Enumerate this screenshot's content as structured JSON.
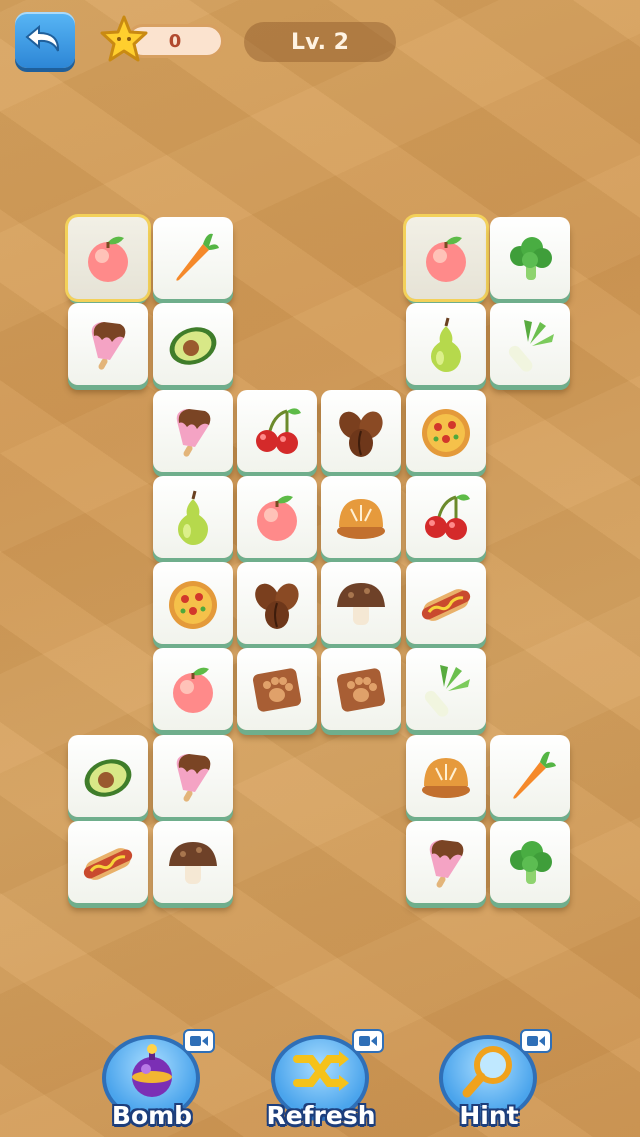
{
  "hud": {
    "back_icon": "undo-arrow-icon",
    "score": "0",
    "level": "Lv. 2"
  },
  "tiles": [
    {
      "item": "peach",
      "selected": true
    },
    {
      "item": "carrot"
    },
    {
      "item": "peach",
      "selected": true
    },
    {
      "item": "broccoli"
    },
    {
      "item": "popsicle"
    },
    {
      "item": "avocado"
    },
    {
      "item": "pear"
    },
    {
      "item": "leek"
    },
    {
      "item": "popsicle"
    },
    {
      "item": "cherry"
    },
    {
      "item": "coffee-beans"
    },
    {
      "item": "pizza"
    },
    {
      "item": "pear"
    },
    {
      "item": "peach"
    },
    {
      "item": "bread"
    },
    {
      "item": "cherry"
    },
    {
      "item": "pizza"
    },
    {
      "item": "coffee-beans"
    },
    {
      "item": "mushroom"
    },
    {
      "item": "hotdog"
    },
    {
      "item": "peach"
    },
    {
      "item": "paw-biscuit"
    },
    {
      "item": "paw-biscuit"
    },
    {
      "item": "leek"
    },
    {
      "item": "avocado"
    },
    {
      "item": "popsicle"
    },
    {
      "item": "bread"
    },
    {
      "item": "carrot"
    },
    {
      "item": "hotdog"
    },
    {
      "item": "mushroom"
    },
    {
      "item": "popsicle"
    },
    {
      "item": "broccoli"
    }
  ],
  "powerups": {
    "bomb": {
      "label": "Bomb",
      "icon": "bomb-icon"
    },
    "refresh": {
      "label": "Refresh",
      "icon": "shuffle-icon"
    },
    "hint": {
      "label": "Hint",
      "icon": "magnifier-icon"
    }
  },
  "colors": {
    "tile_base": "#6fae8c",
    "selected_outline": "#f3d15a",
    "button_blue": "#4aa4ec"
  }
}
